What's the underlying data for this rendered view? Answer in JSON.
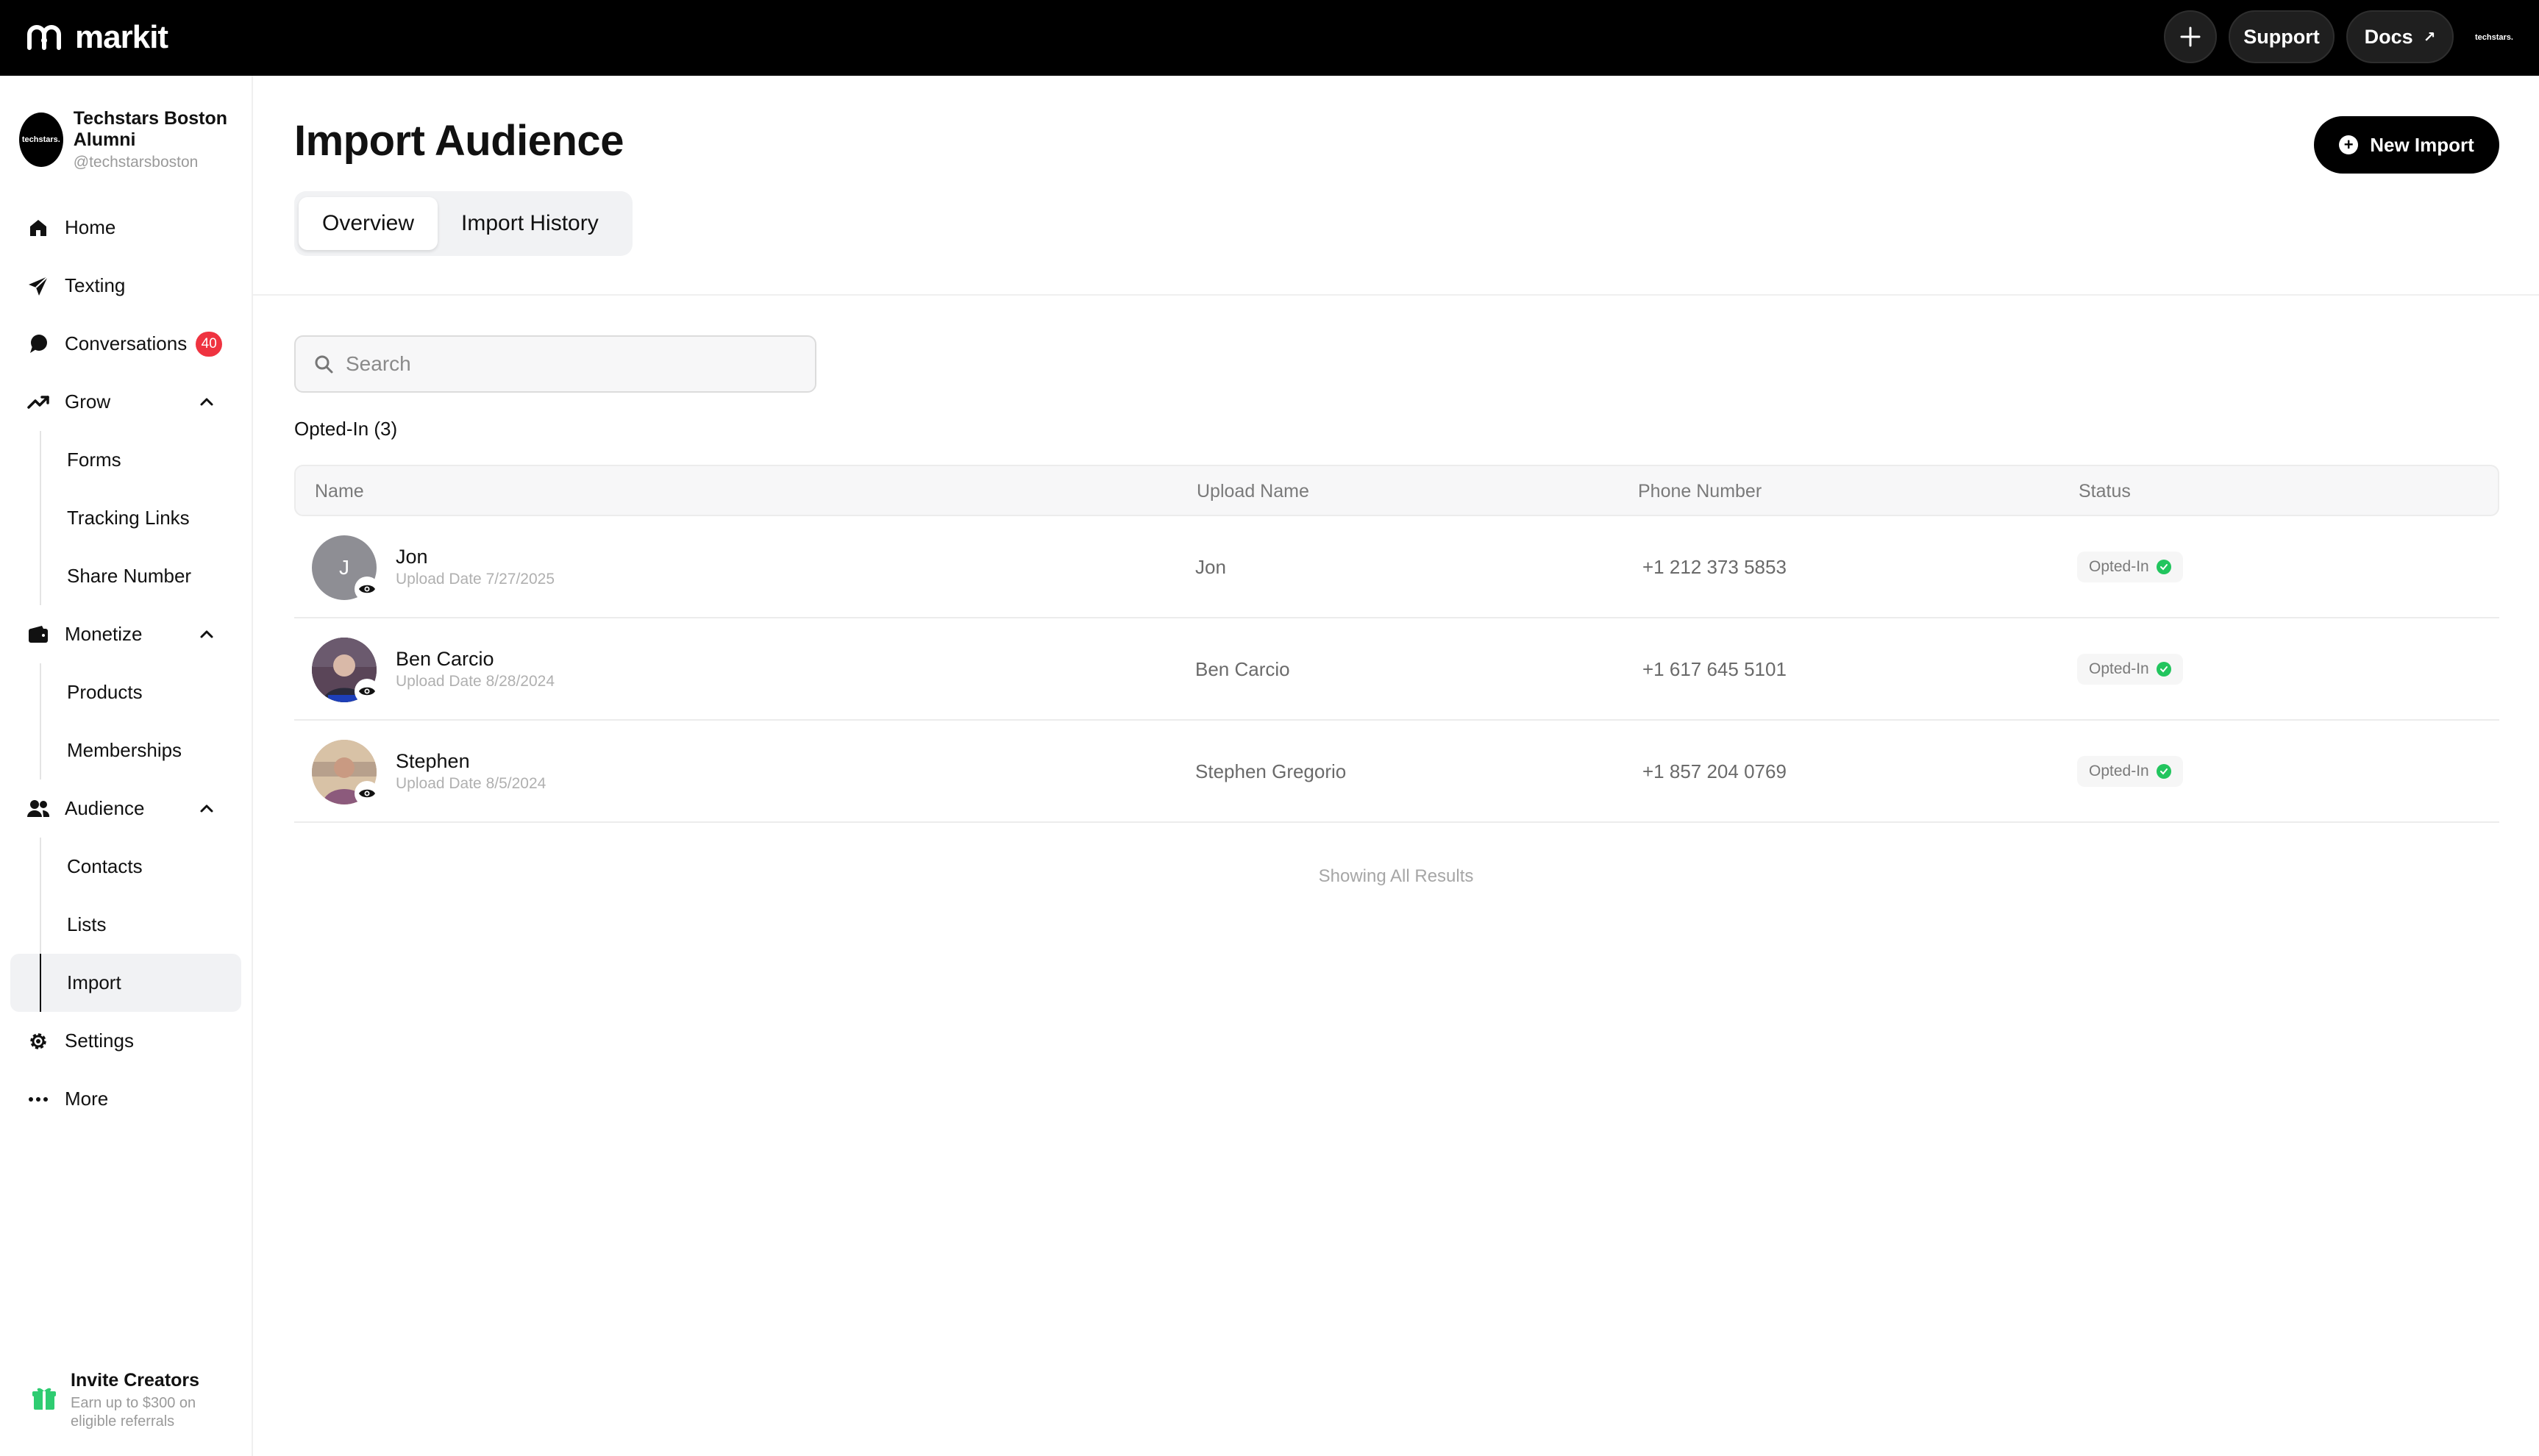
{
  "app": {
    "name": "markit"
  },
  "topbar": {
    "support_label": "Support",
    "docs_label": "Docs",
    "avatar_text": "techstars."
  },
  "account": {
    "name": "Techstars Boston Alumni",
    "handle": "@techstarsboston",
    "avatar_text": "techstars."
  },
  "sidebar": {
    "home": "Home",
    "texting": "Texting",
    "conversations": "Conversations",
    "conversations_count": "40",
    "grow": "Grow",
    "forms": "Forms",
    "tracking_links": "Tracking Links",
    "share_number": "Share Number",
    "monetize": "Monetize",
    "products": "Products",
    "memberships": "Memberships",
    "audience": "Audience",
    "contacts": "Contacts",
    "lists": "Lists",
    "import": "Import",
    "settings": "Settings",
    "more": "More"
  },
  "invite": {
    "title": "Invite Creators",
    "subtitle": "Earn up to $300 on eligible referrals"
  },
  "main": {
    "title": "Import Audience",
    "new_import_label": "New Import",
    "tabs": [
      {
        "label": "Overview",
        "active": true
      },
      {
        "label": "Import History",
        "active": false
      }
    ],
    "search_placeholder": "Search",
    "section_label": "Opted-In (3)",
    "footer_note": "Showing All Results"
  },
  "table": {
    "columns": [
      "Name",
      "Upload Name",
      "Phone Number",
      "Status"
    ],
    "rows": [
      {
        "initial": "J",
        "name": "Jon",
        "upload_date": "Upload Date 7/27/2025",
        "upload_name": "Jon",
        "phone": "+1 212 373 5853",
        "status": "Opted-In"
      },
      {
        "initial": "",
        "name": "Ben Carcio",
        "upload_date": "Upload Date 8/28/2024",
        "upload_name": "Ben Carcio",
        "phone": "+1 617 645 5101",
        "status": "Opted-In"
      },
      {
        "initial": "",
        "name": "Stephen",
        "upload_date": "Upload Date 8/5/2024",
        "upload_name": "Stephen Gregorio",
        "phone": "+1 857 204 0769",
        "status": "Opted-In"
      }
    ]
  },
  "colors": {
    "topbar": "#000000",
    "badge": "#ef3340",
    "status_ok": "#22c55e",
    "active_nav": "#f1f2f4"
  }
}
